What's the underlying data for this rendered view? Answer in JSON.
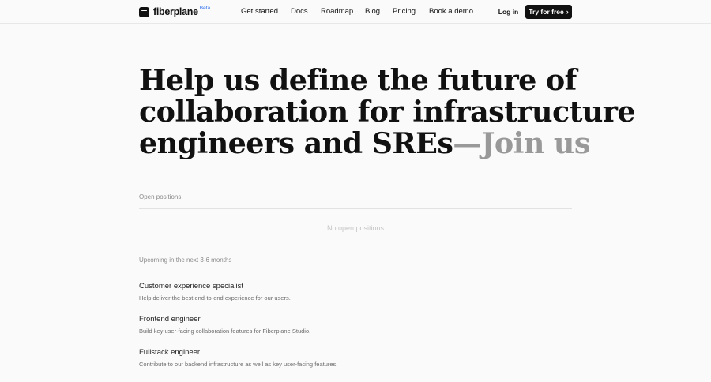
{
  "header": {
    "brand": "fiberplane",
    "badge": "Beta",
    "nav": [
      "Get started",
      "Docs",
      "Roadmap",
      "Blog",
      "Pricing",
      "Book a demo"
    ],
    "login_label": "Log in",
    "cta_label": "Try for free"
  },
  "hero": {
    "line1": "Help us define the future of",
    "line2": "collaboration for infrastructure",
    "line3_main": "engineers and SREs",
    "line3_muted": "—Join us"
  },
  "open_positions": {
    "label": "Open positions",
    "empty_text": "No open positions"
  },
  "upcoming": {
    "label": "Upcoming in the next 3-6 months",
    "jobs": [
      {
        "title": "Customer experience specialist",
        "description": "Help deliver the best end-to-end experience for our users."
      },
      {
        "title": "Frontend engineer",
        "description": "Build key user-facing collaboration features for Fiberplane Studio."
      },
      {
        "title": "Fullstack engineer",
        "description": "Contribute to our backend infrastructure as well as key user-facing features."
      }
    ]
  },
  "colors": {
    "accent_badge": "#2f6fed",
    "cta_background": "#111111",
    "muted_heading": "#999999"
  }
}
